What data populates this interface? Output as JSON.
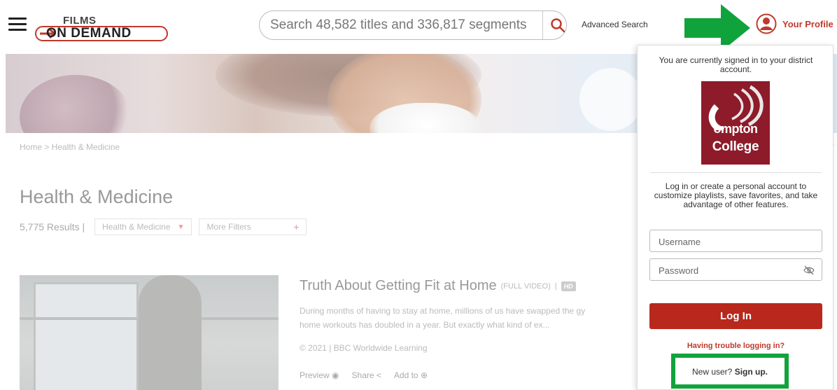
{
  "header": {
    "logo_top": "FILMS",
    "logo_bottom": "ON DEMAND",
    "search_placeholder": "Search 48,582 titles and 336,817 segments",
    "advanced_search": "Advanced Search",
    "profile_label": "Your Profile"
  },
  "breadcrumb": "Home > Health & Medicine",
  "page": {
    "title": "Health & Medicine",
    "result_count": "5,775 Results |",
    "filters": [
      {
        "label": "Health & Medicine",
        "icon": "caret-down-icon"
      },
      {
        "label": "More Filters",
        "icon": "plus-icon"
      }
    ]
  },
  "result_item": {
    "title": "Truth About Getting Fit at Home",
    "type": "(FULL VIDEO)",
    "separator": "|",
    "hd_badge": "HD",
    "description_line1": "During months of having to stay at home, millions of us have swapped the gy",
    "description_line2": "home workouts has doubled in a year. But exactly what kind of ex...",
    "meta": "© 2021 | BBC Worldwide Learning",
    "actions": [
      "Preview",
      "Share",
      "Add to"
    ]
  },
  "profile_panel": {
    "signed_in_text": "You are currently signed in to your district account.",
    "college_logo_line1": "ompton",
    "college_logo_line2": "College",
    "info_text": "Log in or create a personal account to customize playlists, save favorites, and take advantage of other features.",
    "username_placeholder": "Username",
    "password_placeholder": "Password",
    "login_button": "Log In",
    "trouble_link": "Having trouble logging in?",
    "new_user_text": "New user?",
    "signup_link": "Sign up."
  },
  "colors": {
    "brand_red": "#b8281c",
    "highlight_green": "#10a33c"
  }
}
